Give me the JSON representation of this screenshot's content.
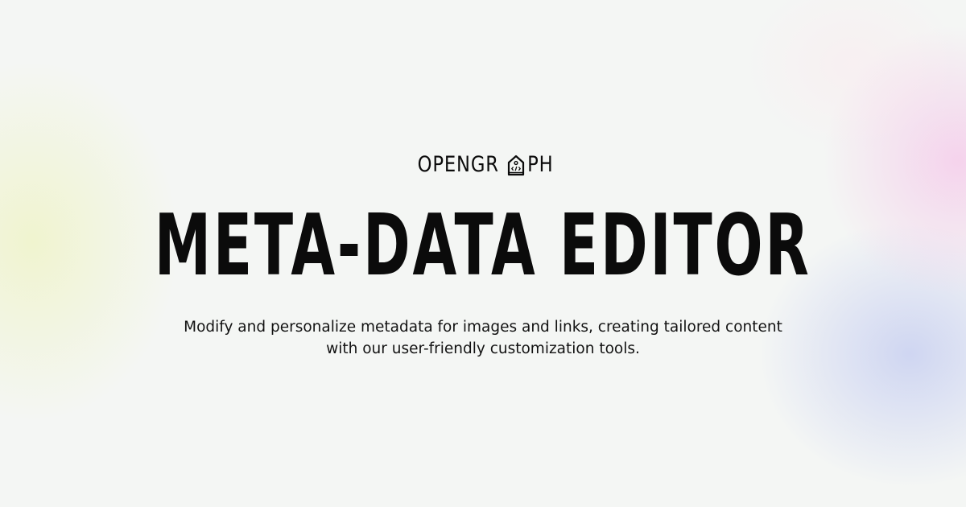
{
  "brand": {
    "part1": "OPENGR",
    "logo_letter_icon": "house-code-icon",
    "part2": "PH"
  },
  "title": "META-DATA EDITOR",
  "description": "Modify and personalize metadata for images and links, creating tailored content with our user-friendly customization tools.",
  "colors": {
    "background": "#f4f6f4",
    "text": "#0b0b0b",
    "glow_left": "#f0f4cd",
    "glow_right_top": "#f5cdeb",
    "glow_right_bottom": "#cdd4f2"
  }
}
